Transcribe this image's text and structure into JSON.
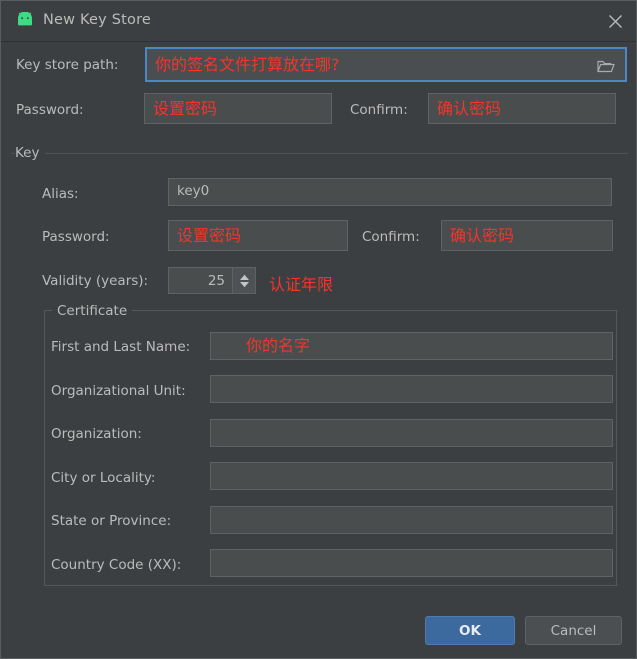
{
  "window": {
    "title": "New Key Store",
    "app_icon": "android-icon",
    "close_icon": "close-icon",
    "accent_color": "#3c6a9e",
    "hint_color": "#f5342b",
    "background_color": "#3c3f41",
    "field_color": "#494d4e",
    "focus_border_color": "#4a88c7"
  },
  "keystore": {
    "path_label": "Key store path:",
    "path_value": "你的签名文件打算放在哪?",
    "path_is_hint": true,
    "browse_icon": "folder-icon",
    "password_label": "Password:",
    "password_value": "设置密码",
    "confirm_label": "Confirm:",
    "confirm_value": "确认密码"
  },
  "key_group": {
    "legend": "Key",
    "alias_label": "Alias:",
    "alias_value": "key0",
    "password_label": "Password:",
    "password_value": "设置密码",
    "confirm_label": "Confirm:",
    "confirm_value": "确认密码",
    "validity_label": "Validity (years):",
    "validity_value": "25",
    "validity_note": "认证年限"
  },
  "certificate": {
    "legend": "Certificate",
    "fields": [
      {
        "label": "First and Last Name:",
        "value": "你的名字",
        "is_hint": true
      },
      {
        "label": "Organizational Unit:",
        "value": "",
        "is_hint": false
      },
      {
        "label": "Organization:",
        "value": "",
        "is_hint": false
      },
      {
        "label": "City or Locality:",
        "value": "",
        "is_hint": false
      },
      {
        "label": "State or Province:",
        "value": "",
        "is_hint": false
      },
      {
        "label": "Country Code (XX):",
        "value": "",
        "is_hint": false
      }
    ]
  },
  "footer": {
    "ok_label": "OK",
    "cancel_label": "Cancel"
  }
}
